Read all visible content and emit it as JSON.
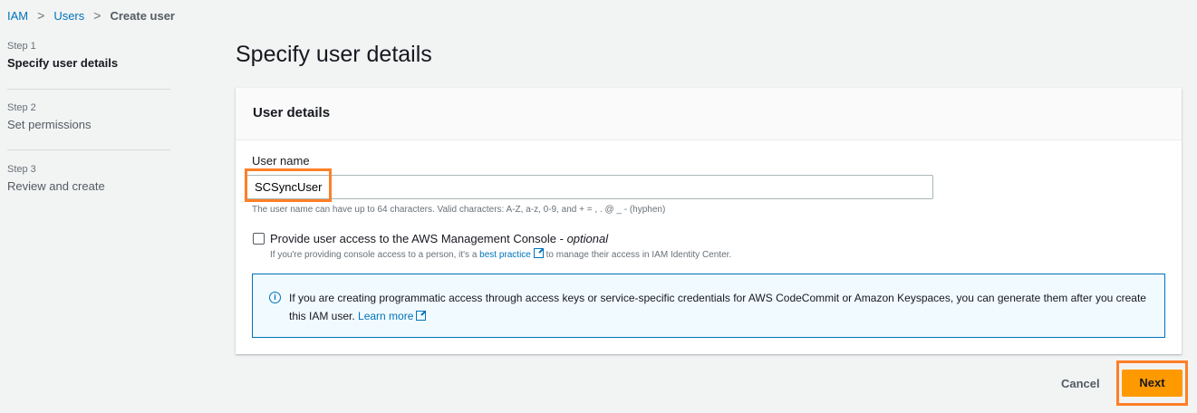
{
  "breadcrumb": {
    "items": [
      "IAM",
      "Users"
    ],
    "current": "Create user"
  },
  "steps": [
    {
      "label": "Step 1",
      "title": "Specify user details"
    },
    {
      "label": "Step 2",
      "title": "Set permissions"
    },
    {
      "label": "Step 3",
      "title": "Review and create"
    }
  ],
  "page_title": "Specify user details",
  "card": {
    "title": "User details",
    "username_label": "User name",
    "username_value": "SCSyncUser",
    "username_hint": "The user name can have up to 64 characters. Valid characters: A-Z, a-z, 0-9, and + = , . @ _ - (hyphen)",
    "console_label": "Provide user access to the AWS Management Console - ",
    "console_optional": "optional",
    "console_hint_pre": "If you're providing console access to a person, it's a ",
    "console_hint_link": "best practice",
    "console_hint_post": " to manage their access in IAM Identity Center.",
    "info_text": "If you are creating programmatic access through access keys or service-specific credentials for AWS CodeCommit or Amazon Keyspaces, you can generate them after you create this IAM user. ",
    "info_link": "Learn more"
  },
  "actions": {
    "cancel": "Cancel",
    "next": "Next"
  }
}
